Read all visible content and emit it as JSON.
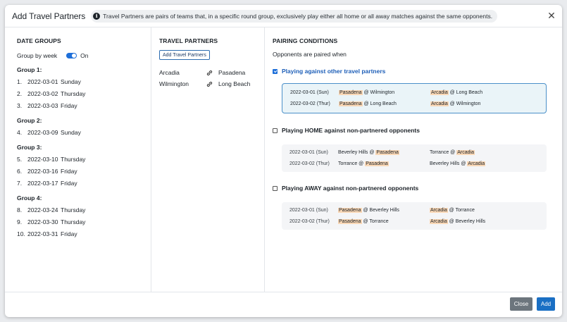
{
  "header": {
    "title": "Add Travel Partners",
    "info": "Travel Partners are pairs of teams that, in a specific round group, exclusively play either all home or all away matches against the same opponents."
  },
  "date_groups": {
    "heading": "DATE GROUPS",
    "group_by_week_label": "Group by week",
    "toggle_state": "On",
    "groups": [
      {
        "title": "Group 1:",
        "dates": [
          {
            "num": "1.",
            "date": "2022-03-01",
            "day": "Sunday"
          },
          {
            "num": "2.",
            "date": "2022-03-02",
            "day": "Thursday"
          },
          {
            "num": "3.",
            "date": "2022-03-03",
            "day": "Friday"
          }
        ]
      },
      {
        "title": "Group 2:",
        "dates": [
          {
            "num": "4.",
            "date": "2022-03-09",
            "day": "Sunday"
          }
        ]
      },
      {
        "title": "Group 3:",
        "dates": [
          {
            "num": "5.",
            "date": "2022-03-10",
            "day": "Thursday"
          },
          {
            "num": "6.",
            "date": "2022-03-16",
            "day": "Friday"
          },
          {
            "num": "7.",
            "date": "2022-03-17",
            "day": "Friday"
          }
        ]
      },
      {
        "title": "Group 4:",
        "dates": [
          {
            "num": "8.",
            "date": "2022-03-24",
            "day": "Thursday"
          },
          {
            "num": "9.",
            "date": "2022-03-30",
            "day": "Thursday"
          },
          {
            "num": "10.",
            "date": "2022-03-31",
            "day": "Friday"
          }
        ]
      }
    ]
  },
  "travel_partners": {
    "heading": "TRAVEL PARTNERS",
    "add_button": "Add Travel Partners",
    "pairs": [
      {
        "a": "Arcadia",
        "b": "Pasadena"
      },
      {
        "a": "Wilmington",
        "b": "Long Beach"
      }
    ]
  },
  "pairing_conditions": {
    "heading": "PAIRING CONDITIONS",
    "subtext": "Opponents are paired when",
    "conditions": [
      {
        "label": "Playing against other travel partners",
        "checked": true,
        "rows": [
          {
            "date": "2022-03-01 (Sun)",
            "m1": {
              "pre": "",
              "hl": "Pasadena",
              "post": " @ Wilmington"
            },
            "m2": {
              "pre": "",
              "hl": "Arcadia",
              "post": " @ Long Beach"
            }
          },
          {
            "date": "2022-03-02 (Thur)",
            "m1": {
              "pre": "",
              "hl": "Pasadena",
              "post": " @ Long Beach"
            },
            "m2": {
              "pre": "",
              "hl": "Arcadia",
              "post": " @ Wilmington"
            }
          }
        ]
      },
      {
        "label": "Playing HOME against non-partnered opponents",
        "checked": false,
        "rows": [
          {
            "date": "2022-03-01 (Sun)",
            "m1": {
              "pre": "Beverley Hills @ ",
              "hl": "Pasadena",
              "post": ""
            },
            "m2": {
              "pre": "Torrance @ ",
              "hl": "Arcadia",
              "post": ""
            }
          },
          {
            "date": "2022-03-02 (Thur)",
            "m1": {
              "pre": "Torrance @ ",
              "hl": "Pasadena",
              "post": ""
            },
            "m2": {
              "pre": "Beverley Hills @ ",
              "hl": "Arcadia",
              "post": ""
            }
          }
        ]
      },
      {
        "label": "Playing AWAY against non-partnered opponents",
        "checked": false,
        "rows": [
          {
            "date": "2022-03-01 (Sun)",
            "m1": {
              "pre": "",
              "hl": "Pasadena",
              "post": " @ Beverley Hills"
            },
            "m2": {
              "pre": "",
              "hl": "Arcadia",
              "post": " @ Torrance"
            }
          },
          {
            "date": "2022-03-02 (Thur)",
            "m1": {
              "pre": "",
              "hl": "Pasadena",
              "post": " @ Torrance"
            },
            "m2": {
              "pre": "",
              "hl": "Arcadia",
              "post": " @ Beverley Hills"
            }
          }
        ]
      }
    ]
  },
  "footer": {
    "close_label": "Close",
    "add_label": "Add"
  },
  "colors": {
    "accent": "#1e6fd9",
    "highlight": "#f9d7b5",
    "close_button": "#6c757d",
    "add_button": "#1a6fc4"
  },
  "icons": {
    "info": "info-icon",
    "close": "close-icon",
    "link": "link-icon",
    "checkbox": "checkbox-icon"
  }
}
